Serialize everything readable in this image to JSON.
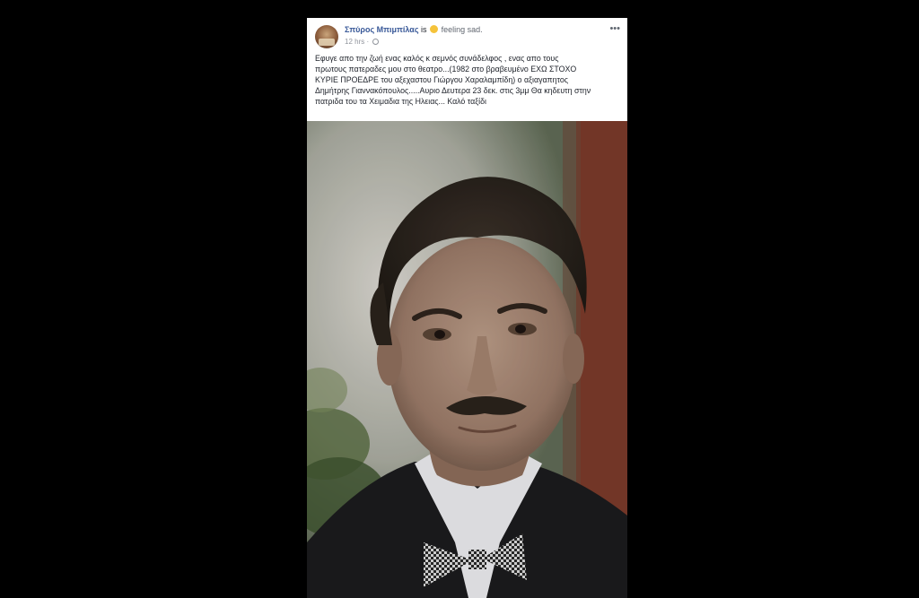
{
  "post": {
    "author": "Σπύρος Μπιμπίλας",
    "is_text": "is",
    "feeling": "feeling sad.",
    "timestamp": "12 hrs",
    "separator": "·",
    "more_menu": "•••",
    "text": "Εφυγε απο την ζωή ενας καλός κ σεμνός συνάδελφος , ενας απο τους\nπρωτους πατεραδες μου στο θεατρο...(1982 στο βραβευμένο ΕΧΩ ΣΤΟΧΟ\nΚΥΡΙΕ ΠΡΟΕΔΡΕ του αξεχαστου Γιώργου Χαραλαμπίδη) ο αξιαγαπητος\nΔημήτρης Γιαννακόπουλος.....Αυριο Δευτερα 23 δεκ. στις 3μμ Θα κηδευτη στην\nπατριδα του τα Χειμαδια της Ηλειας... Καλό ταξίδι"
  },
  "icons": {
    "feeling": "sad-face-emoji-icon",
    "privacy": "globe-icon",
    "more": "more-options-icon"
  },
  "colors": {
    "page_background": "#000000",
    "card_background": "#ffffff",
    "author_link": "#385898",
    "meta_text": "#90949c"
  }
}
